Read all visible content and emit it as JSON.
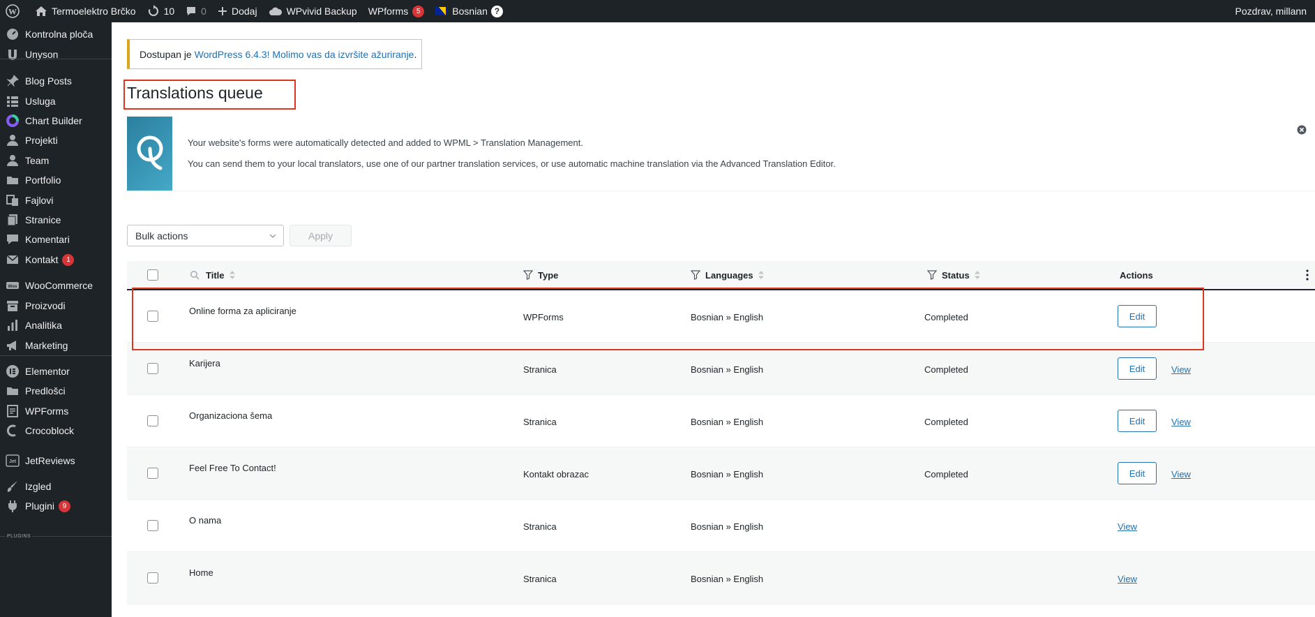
{
  "adminbar": {
    "site_name": "Termoelektro Brčko",
    "updates_count": "10",
    "comments_count": "0",
    "add_new": "Dodaj",
    "backup": "WPvivid Backup",
    "wpforms": "WPforms",
    "wpforms_badge": "5",
    "language": "Bosnian",
    "language_badge": "?",
    "greeting": "Pozdrav, millann"
  },
  "sidebar": {
    "items": [
      {
        "label": "Kontrolna ploča",
        "icon": "dashboard-icon"
      },
      {
        "label": "Unyson",
        "icon": "unyson-icon"
      },
      {
        "label": "Blog Posts",
        "icon": "pin-icon"
      },
      {
        "label": "Usluga",
        "icon": "grid-icon"
      },
      {
        "label": "Chart Builder",
        "icon": "chart-builder-icon"
      },
      {
        "label": "Projekti",
        "icon": "user-icon"
      },
      {
        "label": "Team",
        "icon": "user-icon"
      },
      {
        "label": "Portfolio",
        "icon": "folder-icon"
      },
      {
        "label": "Fajlovi",
        "icon": "media-icon"
      },
      {
        "label": "Stranice",
        "icon": "pages-icon"
      },
      {
        "label": "Komentari",
        "icon": "comment-icon"
      },
      {
        "label": "Kontakt",
        "icon": "mail-icon",
        "badge": "1"
      },
      {
        "label": "WooCommerce",
        "icon": "woocommerce-icon"
      },
      {
        "label": "Proizvodi",
        "icon": "archive-icon"
      },
      {
        "label": "Analitika",
        "icon": "bar-chart-icon"
      },
      {
        "label": "Marketing",
        "icon": "megaphone-icon"
      },
      {
        "label": "Elementor",
        "icon": "elementor-icon"
      },
      {
        "label": "Predlošci",
        "icon": "folder-icon"
      },
      {
        "label": "WPForms",
        "icon": "form-icon"
      },
      {
        "label": "Crocoblock",
        "icon": "crocoblock-icon"
      },
      {
        "label": "JetReviews",
        "icon": "jet-icon"
      },
      {
        "label": "Izgled",
        "icon": "brush-icon"
      },
      {
        "label": "Plugini",
        "icon": "plugin-icon",
        "badge": "9"
      }
    ],
    "plugins_tag": "PLUGINS"
  },
  "notice": {
    "prefix": "Dostupan je ",
    "link": "WordPress 6.4.3",
    "suffix": "! Molimo vas da izvršite ažuriranje",
    "suffix2": "."
  },
  "page_title": "Translations queue",
  "banner": {
    "line1": "Your website's forms were automatically detected and added to WPML > Translation Management.",
    "line2": "You can send them to your local translators, use one of our partner translation services, or use automatic machine translation via the Advanced Translation Editor."
  },
  "bulk": {
    "placeholder": "Bulk actions",
    "apply": "Apply"
  },
  "table": {
    "headers": {
      "title": "Title",
      "type": "Type",
      "languages": "Languages",
      "status": "Status",
      "actions": "Actions"
    },
    "edit_label": "Edit",
    "view_label": "View",
    "rows": [
      {
        "title": "Online forma za apliciranje",
        "type": "WPForms",
        "languages": "Bosnian » English",
        "status": "Completed",
        "edit": true,
        "view": false
      },
      {
        "title": "Karijera",
        "type": "Stranica",
        "languages": "Bosnian » English",
        "status": "Completed",
        "edit": true,
        "view": true
      },
      {
        "title": "Organizaciona šema",
        "type": "Stranica",
        "languages": "Bosnian » English",
        "status": "Completed",
        "edit": true,
        "view": true
      },
      {
        "title": "Feel Free To Contact!",
        "type": "Kontakt obrazac",
        "languages": "Bosnian » English",
        "status": "Completed",
        "edit": true,
        "view": true
      },
      {
        "title": "O nama",
        "type": "Stranica",
        "languages": "Bosnian » English",
        "status": "",
        "edit": false,
        "view": true
      },
      {
        "title": "Home",
        "type": "Stranica",
        "languages": "Bosnian » English",
        "status": "",
        "edit": false,
        "view": true
      }
    ]
  }
}
